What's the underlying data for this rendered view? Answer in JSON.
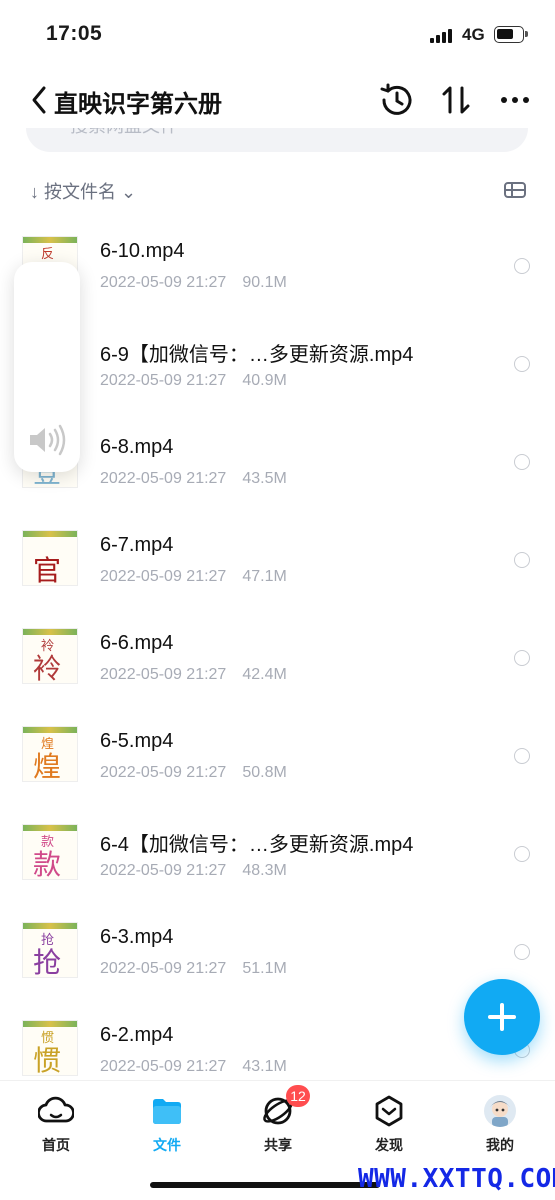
{
  "status_bar": {
    "time": "17:05",
    "network": "4G"
  },
  "header": {
    "title": "直映识字第六册"
  },
  "search": {
    "placeholder": "搜索网盘文件"
  },
  "sort": {
    "label": "↓ 按文件名 ⌄"
  },
  "files": [
    {
      "name": "6-10.mp4",
      "date": "2022-05-09 21:27",
      "size": "90.1M",
      "thumb_small": "反",
      "thumb_big": "",
      "color": "#c0392b"
    },
    {
      "name": "6-9【加微信号：…多更新资源.mp4",
      "date": "2022-05-09 21:27",
      "size": "40.9M",
      "thumb_small": "",
      "thumb_big": "",
      "color": "#999999"
    },
    {
      "name": "6-8.mp4",
      "date": "2022-05-09 21:27",
      "size": "43.5M",
      "thumb_small": "",
      "thumb_big": "登",
      "color": "#7fb4d0"
    },
    {
      "name": "6-7.mp4",
      "date": "2022-05-09 21:27",
      "size": "47.1M",
      "thumb_small": "",
      "thumb_big": "官",
      "color": "#a61c1c"
    },
    {
      "name": "6-6.mp4",
      "date": "2022-05-09 21:27",
      "size": "42.4M",
      "thumb_small": "袊",
      "thumb_big": "袊",
      "color": "#b03a3a"
    },
    {
      "name": "6-5.mp4",
      "date": "2022-05-09 21:27",
      "size": "50.8M",
      "thumb_small": "煌",
      "thumb_big": "煌",
      "color": "#e07a1f"
    },
    {
      "name": "6-4【加微信号：…多更新资源.mp4",
      "date": "2022-05-09 21:27",
      "size": "48.3M",
      "thumb_small": "款",
      "thumb_big": "款",
      "color": "#d04a8a"
    },
    {
      "name": "6-3.mp4",
      "date": "2022-05-09 21:27",
      "size": "51.1M",
      "thumb_small": "抢",
      "thumb_big": "抢",
      "color": "#8a3fa0"
    },
    {
      "name": "6-2.mp4",
      "date": "2022-05-09 21:27",
      "size": "43.1M",
      "thumb_small": "惯",
      "thumb_big": "惯",
      "color": "#c9a227"
    }
  ],
  "tabs": [
    {
      "label": "首页",
      "icon": "cloud-icon"
    },
    {
      "label": "文件",
      "icon": "folder-icon"
    },
    {
      "label": "共享",
      "icon": "share-icon",
      "badge": "12"
    },
    {
      "label": "发现",
      "icon": "discover-icon"
    },
    {
      "label": "我的",
      "icon": "avatar-icon"
    }
  ],
  "watermark": "WWW.XXTTQ.COM",
  "colors": {
    "accent": "#11aaf3",
    "badge": "#ff4d4f",
    "watermark": "#1428e6"
  }
}
